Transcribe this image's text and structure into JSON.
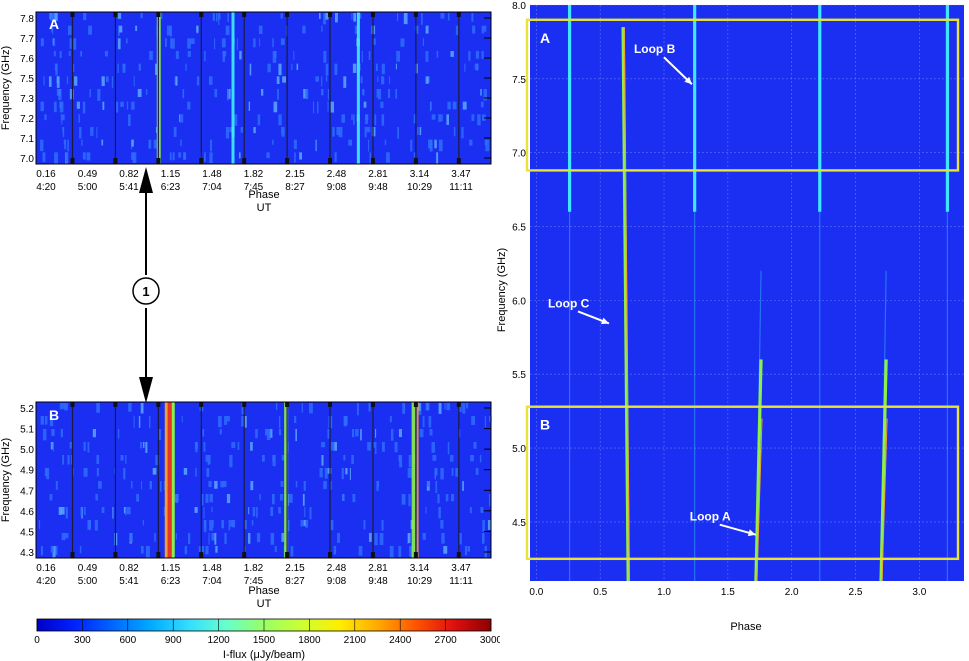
{
  "colors": {
    "background": "#1a2ff2",
    "panel_box": "#e8e23a",
    "stripe_cyan": "#3ff0ff",
    "stripe_green": "#8cf04a",
    "stripe_red": "#e8332a",
    "stripe_orange": "#f0a030",
    "stripe_mid": "#2f6cff"
  },
  "colormap": [
    "#0000c8",
    "#0022ff",
    "#0066ff",
    "#00aaff",
    "#33ddff",
    "#66ffcc",
    "#99ff66",
    "#ccff33",
    "#ffee00",
    "#ffaa00",
    "#ff5500",
    "#e01010",
    "#8b0000"
  ],
  "chart_data": [
    {
      "type": "heatmap",
      "panel_label": "A",
      "ylabel": "Frequency (GHz)",
      "yticks": [
        "7.8",
        "7.7",
        "7.6",
        "7.5",
        "7.3",
        "7.2",
        "7.1",
        "7.0"
      ],
      "xticks_phase": [
        "0.16",
        "0.49",
        "0.82",
        "1.15",
        "1.48",
        "1.82",
        "2.15",
        "2.48",
        "2.81",
        "3.14",
        "3.47"
      ],
      "xticks_ut": [
        "4:20",
        "5:00",
        "5:41",
        "6:23",
        "7:04",
        "7:45",
        "8:27",
        "9:08",
        "9:48",
        "10:29",
        "11:11"
      ],
      "xlabel_phase": "Phase",
      "xlabel_ut": "UT",
      "bright_phases": [
        0.82,
        1.48,
        2.48
      ]
    },
    {
      "type": "heatmap",
      "panel_label": "B",
      "ylabel": "Frequency (GHz)",
      "yticks": [
        "5.2",
        "5.1",
        "5.0",
        "4.9",
        "4.7",
        "4.6",
        "4.5",
        "4.3"
      ],
      "xticks_phase": [
        "0.16",
        "0.49",
        "0.82",
        "1.15",
        "1.48",
        "1.82",
        "2.15",
        "2.48",
        "2.81",
        "3.14",
        "3.47"
      ],
      "xticks_ut": [
        "4:20",
        "5:00",
        "5:41",
        "6:23",
        "7:04",
        "7:45",
        "8:27",
        "9:08",
        "9:48",
        "10:29",
        "11:11"
      ],
      "xlabel_phase": "Phase",
      "xlabel_ut": "UT",
      "bright_phases": [
        0.82,
        1.82,
        3.14
      ]
    },
    {
      "type": "heatmap",
      "ylabel": "Frequency (GHz)",
      "xlabel": "Phase",
      "xlim": [
        -0.05,
        3.35
      ],
      "ylim": [
        4.1,
        8.0
      ],
      "xticks": [
        "0.0",
        "0.5",
        "1.0",
        "1.5",
        "2.0",
        "2.5",
        "3.0"
      ],
      "yticks": [
        "4.5",
        "5.0",
        "5.5",
        "6.0",
        "6.5",
        "7.0",
        "7.5",
        "8.0"
      ],
      "boxes": [
        {
          "label": "A",
          "y_range": [
            6.88,
            7.9
          ]
        },
        {
          "label": "B",
          "y_range": [
            4.25,
            5.28
          ]
        }
      ],
      "annotations": [
        {
          "text": "Loop B",
          "x": 1.25,
          "y": 7.45
        },
        {
          "text": "Loop C",
          "x": 0.6,
          "y": 5.83
        },
        {
          "text": "Loop A",
          "x": 1.75,
          "y": 4.4
        }
      ],
      "loops": [
        {
          "name": "Loop C",
          "x_bottom": 0.72,
          "x_top": 0.68
        },
        {
          "name": "Loop A",
          "x_bottom": 1.72,
          "x_top": 1.76
        },
        {
          "name": "Loop A",
          "x_bottom": 2.7,
          "x_top": 2.74
        },
        {
          "name": "Loop B",
          "x_bottom": 0.26,
          "x_top": 0.26
        },
        {
          "name": "Loop B",
          "x_bottom": 1.24,
          "x_top": 1.24
        },
        {
          "name": "Loop B",
          "x_bottom": 2.22,
          "x_top": 2.22
        },
        {
          "name": "Loop B",
          "x_bottom": 3.22,
          "x_top": 3.22
        }
      ]
    }
  ],
  "colorbar": {
    "ticks": [
      "0",
      "300",
      "600",
      "900",
      "1200",
      "1500",
      "1800",
      "2100",
      "2400",
      "2700",
      "3000"
    ],
    "label": "I-flux (μJy/beam)"
  },
  "callout": {
    "label": "1"
  }
}
